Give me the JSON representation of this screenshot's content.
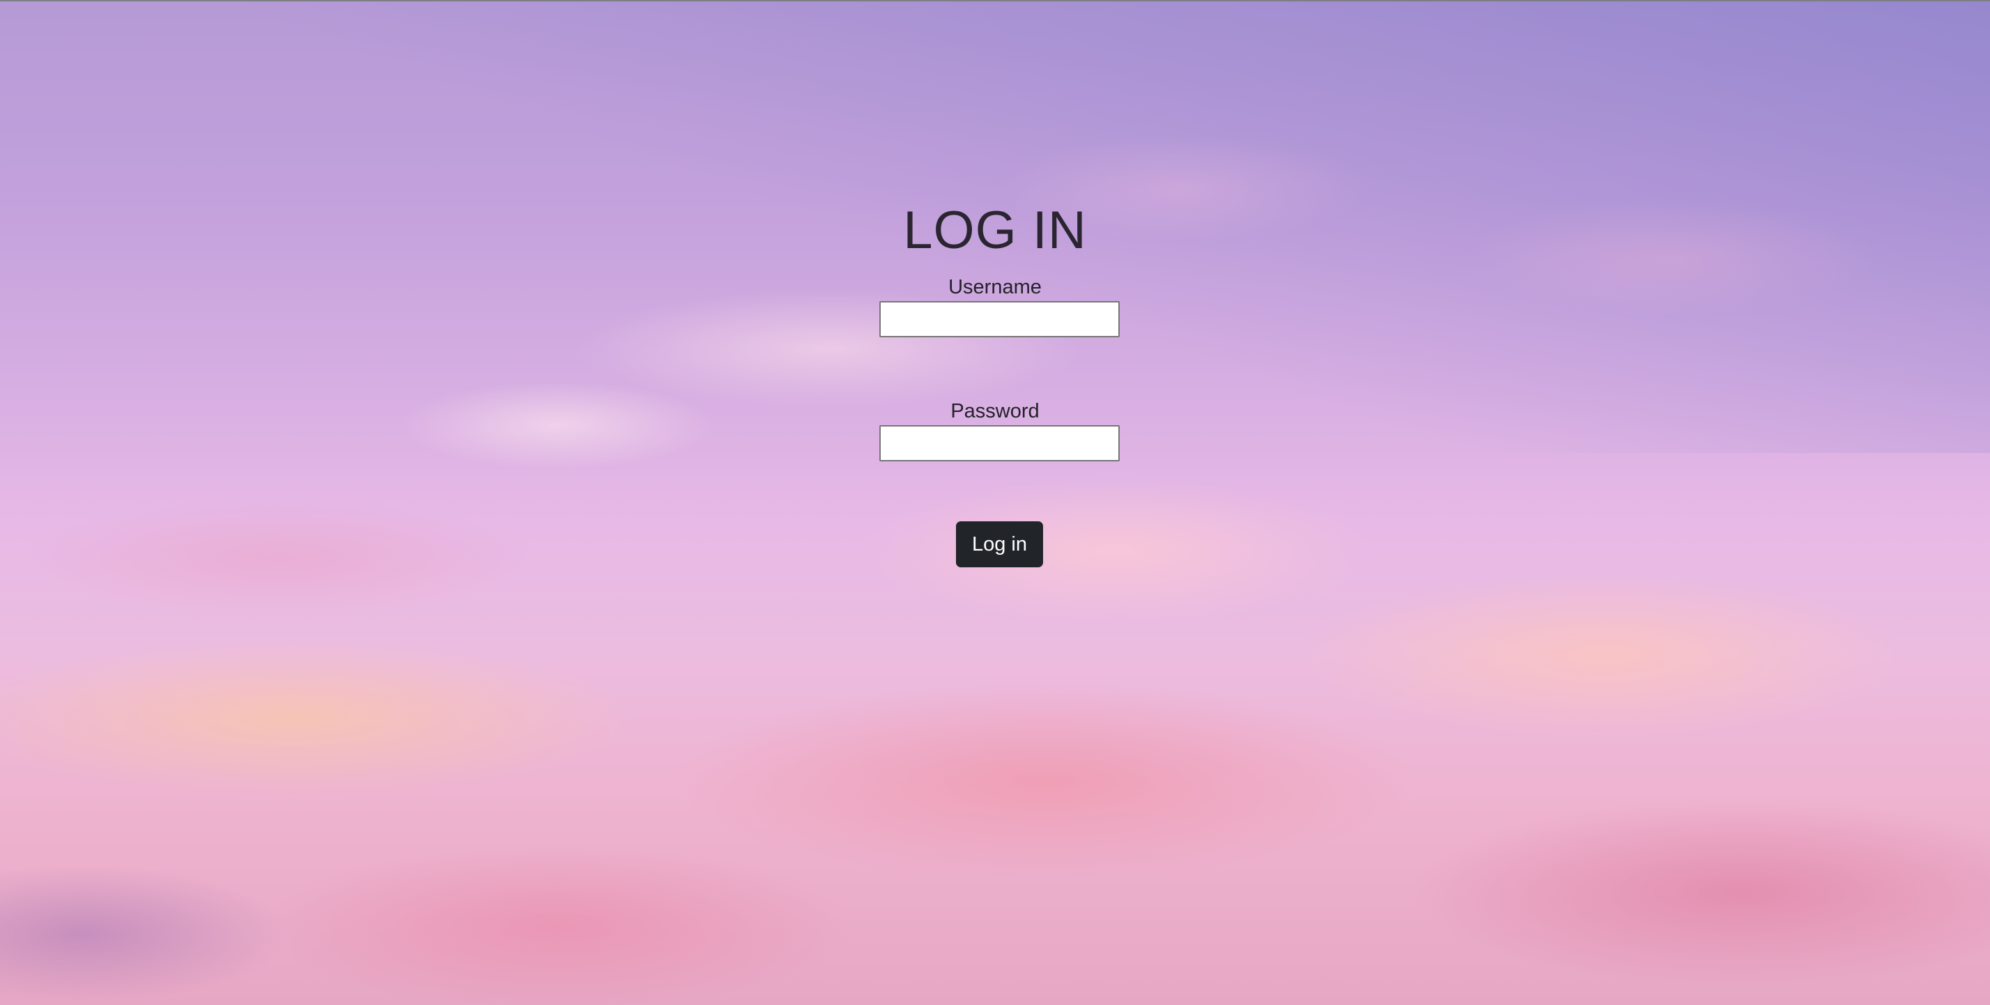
{
  "login": {
    "title": "LOG IN",
    "username_label": "Username",
    "username_value": "",
    "password_label": "Password",
    "password_value": "",
    "submit_label": "Log in"
  },
  "theme": {
    "button_color": "#212529",
    "text_color": "#212529",
    "background": "pink-purple sunset sky with clouds"
  }
}
